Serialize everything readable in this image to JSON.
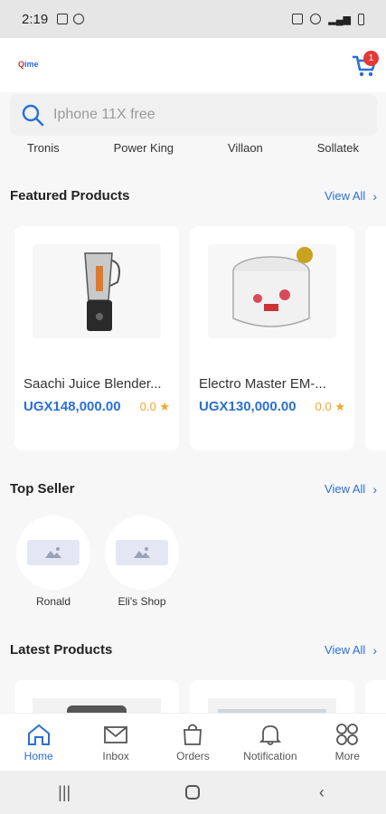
{
  "status_bar": {
    "time": "2:19"
  },
  "header": {
    "logo_text_1": "Q",
    "logo_text_2": "ime",
    "cart_count": "1"
  },
  "search": {
    "placeholder": "Iphone 11X free"
  },
  "brands": [
    "Tronis",
    "Power King",
    "Villaon",
    "Sollatek"
  ],
  "featured": {
    "title": "Featured Products",
    "view_all": "View All",
    "products": [
      {
        "name": "Saachi Juice Blender...",
        "price": "UGX148,000.00",
        "rating": "0.0"
      },
      {
        "name": "Electro Master EM-...",
        "price": "UGX130,000.00",
        "rating": "0.0"
      }
    ]
  },
  "top_seller": {
    "title": "Top Seller",
    "view_all": "View All",
    "sellers": [
      {
        "name": "Ronald"
      },
      {
        "name": "Eli's Shop"
      }
    ]
  },
  "latest": {
    "title": "Latest Products",
    "view_all": "View All"
  },
  "bottom_nav": [
    {
      "label": "Home",
      "icon": "home-icon"
    },
    {
      "label": "Inbox",
      "icon": "mail-icon"
    },
    {
      "label": "Orders",
      "icon": "bag-icon"
    },
    {
      "label": "Notification",
      "icon": "bell-icon"
    },
    {
      "label": "More",
      "icon": "grid-icon"
    }
  ],
  "colors": {
    "accent": "#2a6fd6",
    "badge": "#e53935",
    "rating": "#f5a623"
  }
}
